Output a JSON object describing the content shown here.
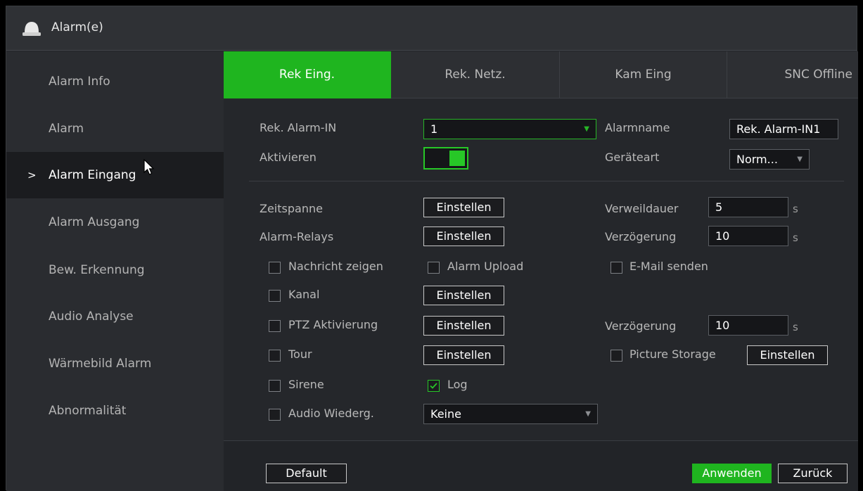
{
  "window": {
    "title": "Alarm(e)",
    "title_icon": "alarm-bell-icon"
  },
  "sidebar": {
    "items": [
      {
        "label": "Alarm Info"
      },
      {
        "label": "Alarm"
      },
      {
        "label": "Alarm Eingang",
        "active": true
      },
      {
        "label": "Alarm Ausgang"
      },
      {
        "label": "Bew. Erkennung"
      },
      {
        "label": "Audio Analyse"
      },
      {
        "label": "Wärmebild Alarm"
      },
      {
        "label": "Abnormalität"
      }
    ],
    "chevron": ">"
  },
  "tabs": [
    {
      "label": "Rek Eing.",
      "active": true
    },
    {
      "label": "Rek. Netz."
    },
    {
      "label": "Kam Eing"
    },
    {
      "label": "SNC Offline"
    }
  ],
  "form": {
    "alarm_in_label": "Rek. Alarm-IN",
    "alarm_in_value": "1",
    "alarm_name_label": "Alarmname",
    "alarm_name_value": "Rek. Alarm-IN1",
    "enable_label": "Aktivieren",
    "enable_on": true,
    "device_type_label": "Geräteart",
    "device_type_value": "Norm...",
    "period_label": "Zeitspanne",
    "period_button": "Einstellen",
    "dwell_label": "Verweildauer",
    "dwell_value": "5",
    "dwell_unit": "s",
    "relays_label": "Alarm-Relays",
    "relays_button": "Einstellen",
    "delay_label": "Verzögerung",
    "delay_value": "10",
    "delay_unit": "s",
    "show_message_label": "Nachricht zeigen",
    "show_message_checked": false,
    "alarm_upload_label": "Alarm Upload",
    "alarm_upload_checked": false,
    "send_email_label": "E-Mail senden",
    "send_email_checked": false,
    "channel_label": "Kanal",
    "channel_checked": false,
    "channel_button": "Einstellen",
    "ptz_label": "PTZ Aktivierung",
    "ptz_checked": false,
    "ptz_button": "Einstellen",
    "ptz_delay_label": "Verzögerung",
    "ptz_delay_value": "10",
    "ptz_delay_unit": "s",
    "tour_label": "Tour",
    "tour_checked": false,
    "tour_button": "Einstellen",
    "picture_storage_label": "Picture Storage",
    "picture_storage_checked": false,
    "picture_storage_button": "Einstellen",
    "siren_label": "Sirene",
    "siren_checked": false,
    "log_label": "Log",
    "log_checked": true,
    "audio_label": "Audio Wiederg.",
    "audio_checked": false,
    "audio_value": "Keine"
  },
  "footer": {
    "default_button": "Default",
    "apply_button": "Anwenden",
    "back_button": "Zurück"
  },
  "colors": {
    "accent": "#1fb51f",
    "background": "#25272b",
    "sidebar": "#2a2c30"
  }
}
